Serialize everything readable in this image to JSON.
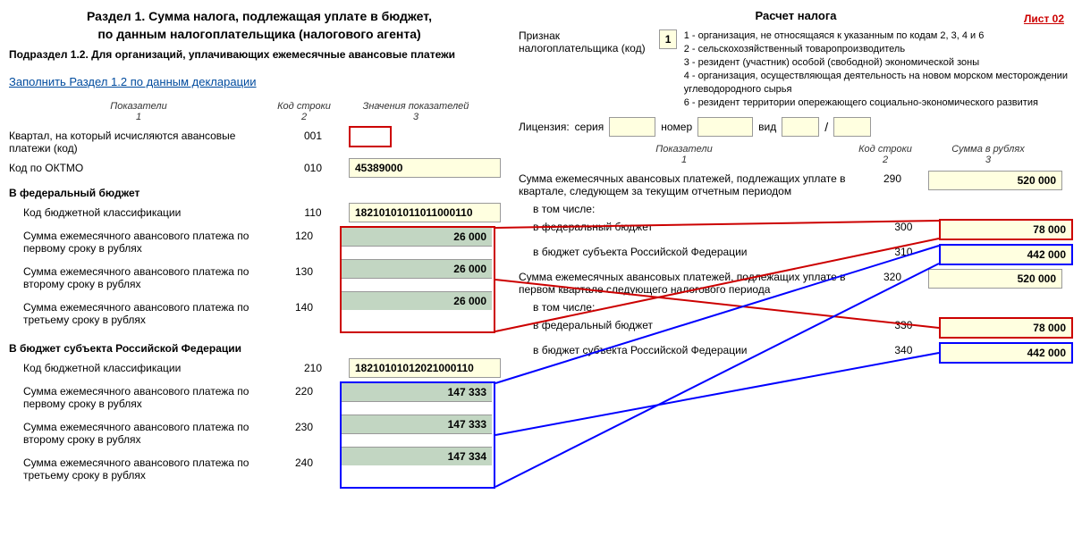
{
  "left": {
    "title1": "Раздел 1. Сумма налога, подлежащая уплате в бюджет,",
    "title2": "по данным налогоплательщика (налогового агента)",
    "sub": "Подраздел 1.2. Для организаций, уплачивающих ежемесячные авансовые платежи",
    "link": "Заполнить Раздел 1.2 по данным декларации",
    "th": {
      "c1": "Показатели",
      "c1n": "1",
      "c2": "Код строки",
      "c2n": "2",
      "c3": "Значения показателей",
      "c3n": "3"
    },
    "r001": {
      "lbl": "Квартал, на который исчисляются авансовые платежи (код)",
      "code": "001",
      "val": ""
    },
    "r010": {
      "lbl": "Код по ОКТМО",
      "code": "010",
      "val": "45389000"
    },
    "fed_section": "В федеральный бюджет",
    "r110": {
      "lbl": "Код бюджетной классификации",
      "code": "110",
      "val": "18210101011011000110"
    },
    "r120": {
      "lbl": "Сумма ежемесячного авансового платежа по первому сроку в рублях",
      "code": "120",
      "val": "26 000"
    },
    "r130": {
      "lbl": "Сумма ежемесячного авансового платежа по второму сроку в рублях",
      "code": "130",
      "val": "26 000"
    },
    "r140": {
      "lbl": "Сумма ежемесячного авансового платежа по третьему сроку в рублях",
      "code": "140",
      "val": "26 000"
    },
    "sub_section": "В бюджет субъекта Российской Федерации",
    "r210": {
      "lbl": "Код бюджетной классификации",
      "code": "210",
      "val": "18210101012021000110"
    },
    "r220": {
      "lbl": "Сумма ежемесячного авансового платежа по первому сроку в рублях",
      "code": "220",
      "val": "147 333"
    },
    "r230": {
      "lbl": "Сумма ежемесячного авансового платежа по второму сроку в рублях",
      "code": "230",
      "val": "147 333"
    },
    "r240": {
      "lbl": "Сумма ежемесячного авансового платежа по третьему сроку в рублях",
      "code": "240",
      "val": "147 334"
    }
  },
  "right": {
    "sheet": "Лист 02",
    "title": "Расчет налога",
    "taxpayer_lbl": "Признак налогоплательщика (код)",
    "taxpayer_code": "1",
    "legend": [
      "1 - организация, не относящаяся к указанным по кодам 2, 3, 4 и 6",
      "2 - сельскохозяйственный товаропроизводитель",
      "3 - резидент (участник) особой (свободной) экономической зоны",
      "4 - организация, осуществляющая деятельность на новом морском месторождении углеводородного сырья",
      "6 - резидент территории опережающего социально-экономического развития"
    ],
    "license": {
      "lbl": "Лицензия:",
      "series": "серия",
      "number": "номер",
      "kind": "вид"
    },
    "th": {
      "c1": "Показатели",
      "c1n": "1",
      "c2": "Код строки",
      "c2n": "2",
      "c3": "Сумма в рублях",
      "c3n": "3"
    },
    "r290": {
      "lbl": "Сумма ежемесячных авансовых платежей, подлежащих уплате в квартале, следующем за текущим отчетным периодом",
      "code": "290",
      "val": "520 000"
    },
    "incl": "в том числе:",
    "r300": {
      "lbl": "в федеральный бюджет",
      "code": "300",
      "val": "78 000"
    },
    "r310": {
      "lbl": "в бюджет субъекта Российской Федерации",
      "code": "310",
      "val": "442 000"
    },
    "r320": {
      "lbl": "Сумма ежемесячных авансовых платежей, подлежащих уплате в первом квартале следующего налогового периода",
      "code": "320",
      "val": "520 000"
    },
    "r330": {
      "lbl": "в федеральный бюджет",
      "code": "330",
      "val": "78 000"
    },
    "r340": {
      "lbl": "в бюджет субъекта Российской Федерации",
      "code": "340",
      "val": "442 000"
    }
  }
}
